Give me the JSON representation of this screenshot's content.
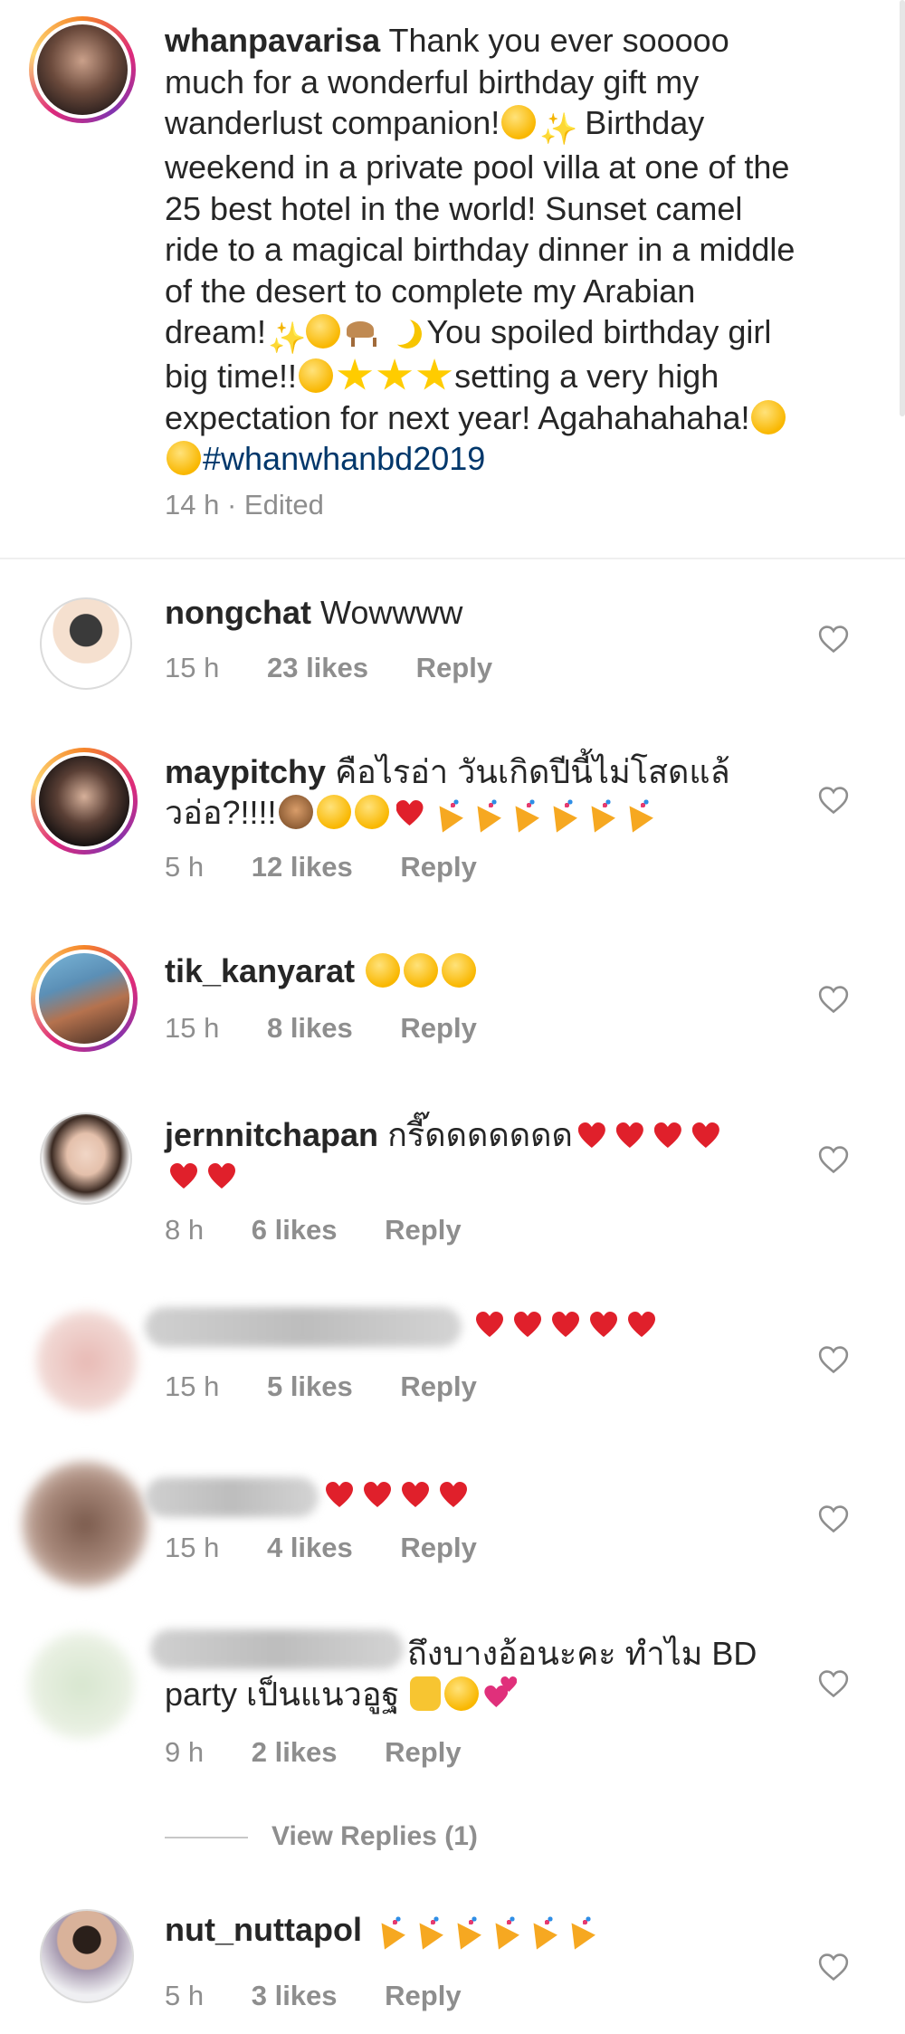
{
  "caption": {
    "username": "whanpavarisa",
    "text_1": "Thank you ever sooooo much for a wonderful birthday gift my wanderlust companion!",
    "text_2": "Birthday weekend in a private pool villa at one of the 25 best hotel in the world! Sunset camel ride to a magical birthday dinner in a middle of the desert to complete my Arabian dream!",
    "text_3": "You spoiled birthday girl big time!!",
    "text_4": "setting a very high expectation for next year! Agahahahaha!",
    "hashtag": "#whanwhanbd2019",
    "time": "14 h",
    "edited": "· Edited"
  },
  "comments": [
    {
      "username": "nongchat",
      "text": "Wowwww",
      "time": "15 h",
      "likes": "23 likes",
      "reply": "Reply"
    },
    {
      "username": "maypitchy",
      "text_line1": "คือไรอ่า วันเกิดปีนี้ไม่โสดแล้",
      "text_line2": "วอ่อ?!!!!",
      "time": "5 h",
      "likes": "12 likes",
      "reply": "Reply"
    },
    {
      "username": "tik_kanyarat",
      "text": "",
      "time": "15 h",
      "likes": "8 likes",
      "reply": "Reply"
    },
    {
      "username": "jernnitchapan",
      "text": "กรี๊ดดดดดดด",
      "time": "8 h",
      "likes": "6 likes",
      "reply": "Reply"
    },
    {
      "username": "",
      "text": "",
      "time": "15 h",
      "likes": "5 likes",
      "reply": "Reply"
    },
    {
      "username": "",
      "text": "",
      "time": "15 h",
      "likes": "4 likes",
      "reply": "Reply"
    },
    {
      "username": "",
      "text_line1": "ถึงบางอ้อนะคะ ทำไม BD",
      "text_line2": "party เป็นแนวอูฐ",
      "time": "9 h",
      "likes": "2 likes",
      "reply": "Reply"
    },
    {
      "username": "nut_nuttapol",
      "text": "",
      "time": "5 h",
      "likes": "3 likes",
      "reply": "Reply"
    }
  ],
  "view_replies": "View Replies (1)",
  "icons": {
    "like": "heart-outline-icon"
  },
  "colors": {
    "text": "#262626",
    "meta": "#8e8e8e",
    "hashtag": "#00376b",
    "heart": "#e0202b"
  }
}
